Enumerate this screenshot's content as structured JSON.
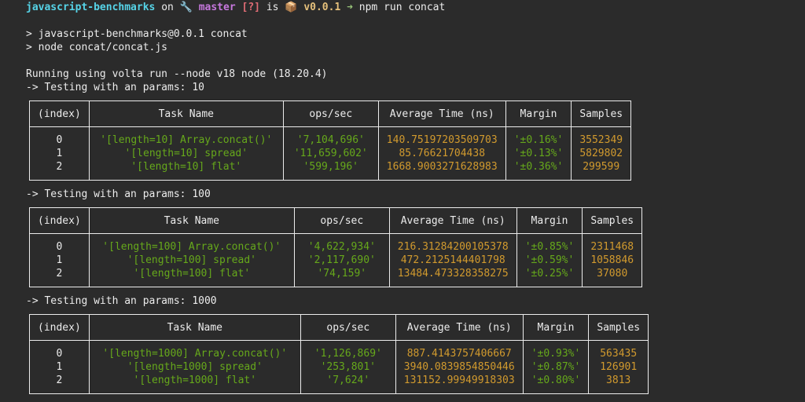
{
  "prompt": {
    "dir": "javascript-benchmarks",
    "on": "on",
    "git_icon": "🔧",
    "branch": "master",
    "status": "[?]",
    "is": "is",
    "pkg_icon": "📦",
    "version": "v0.0.1",
    "arrow": "➜",
    "command": "npm run concat"
  },
  "output": {
    "line1": "> javascript-benchmarks@0.0.1 concat",
    "line2": "> node concat/concat.js",
    "line3": "Running using volta run --node v18 node (18.20.4)"
  },
  "headers": {
    "index": "(index)",
    "name": "Task Name",
    "ops": "ops/sec",
    "avg": "Average Time (ns)",
    "margin": "Margin",
    "samples": "Samples"
  },
  "sections": [
    {
      "heading": "-> Testing with an params: 10",
      "rows": [
        {
          "index": "0",
          "name": "'[length=10] Array.concat()'",
          "ops": "'7,104,696'",
          "avg": "140.75197203509703",
          "margin": "'±0.16%'",
          "samples": "3552349"
        },
        {
          "index": "1",
          "name": "'[length=10] spread'",
          "ops": "'11,659,602'",
          "avg": "85.76621704438",
          "margin": "'±0.13%'",
          "samples": "5829802"
        },
        {
          "index": "2",
          "name": "'[length=10] flat'",
          "ops": "'599,196'",
          "avg": "1668.9003271628983",
          "margin": "'±0.36%'",
          "samples": "299599"
        }
      ]
    },
    {
      "heading": "-> Testing with an params: 100",
      "rows": [
        {
          "index": "0",
          "name": "'[length=100] Array.concat()'",
          "ops": "'4,622,934'",
          "avg": "216.31284200105378",
          "margin": "'±0.85%'",
          "samples": "2311468"
        },
        {
          "index": "1",
          "name": "'[length=100] spread'",
          "ops": "'2,117,690'",
          "avg": "472.2125144401798",
          "margin": "'±0.59%'",
          "samples": "1058846"
        },
        {
          "index": "2",
          "name": "'[length=100] flat'",
          "ops": "'74,159'",
          "avg": "13484.473328358275",
          "margin": "'±0.25%'",
          "samples": "37080"
        }
      ]
    },
    {
      "heading": "-> Testing with an params: 1000",
      "rows": [
        {
          "index": "0",
          "name": "'[length=1000] Array.concat()'",
          "ops": "'1,126,869'",
          "avg": "887.4143757406667",
          "margin": "'±0.93%'",
          "samples": "563435"
        },
        {
          "index": "1",
          "name": "'[length=1000] spread'",
          "ops": "'253,801'",
          "avg": "3940.0839854850446",
          "margin": "'±0.87%'",
          "samples": "126901"
        },
        {
          "index": "2",
          "name": "'[length=1000] flat'",
          "ops": "'7,624'",
          "avg": "131152.99949918303",
          "margin": "'±0.80%'",
          "samples": "3813"
        }
      ]
    }
  ]
}
